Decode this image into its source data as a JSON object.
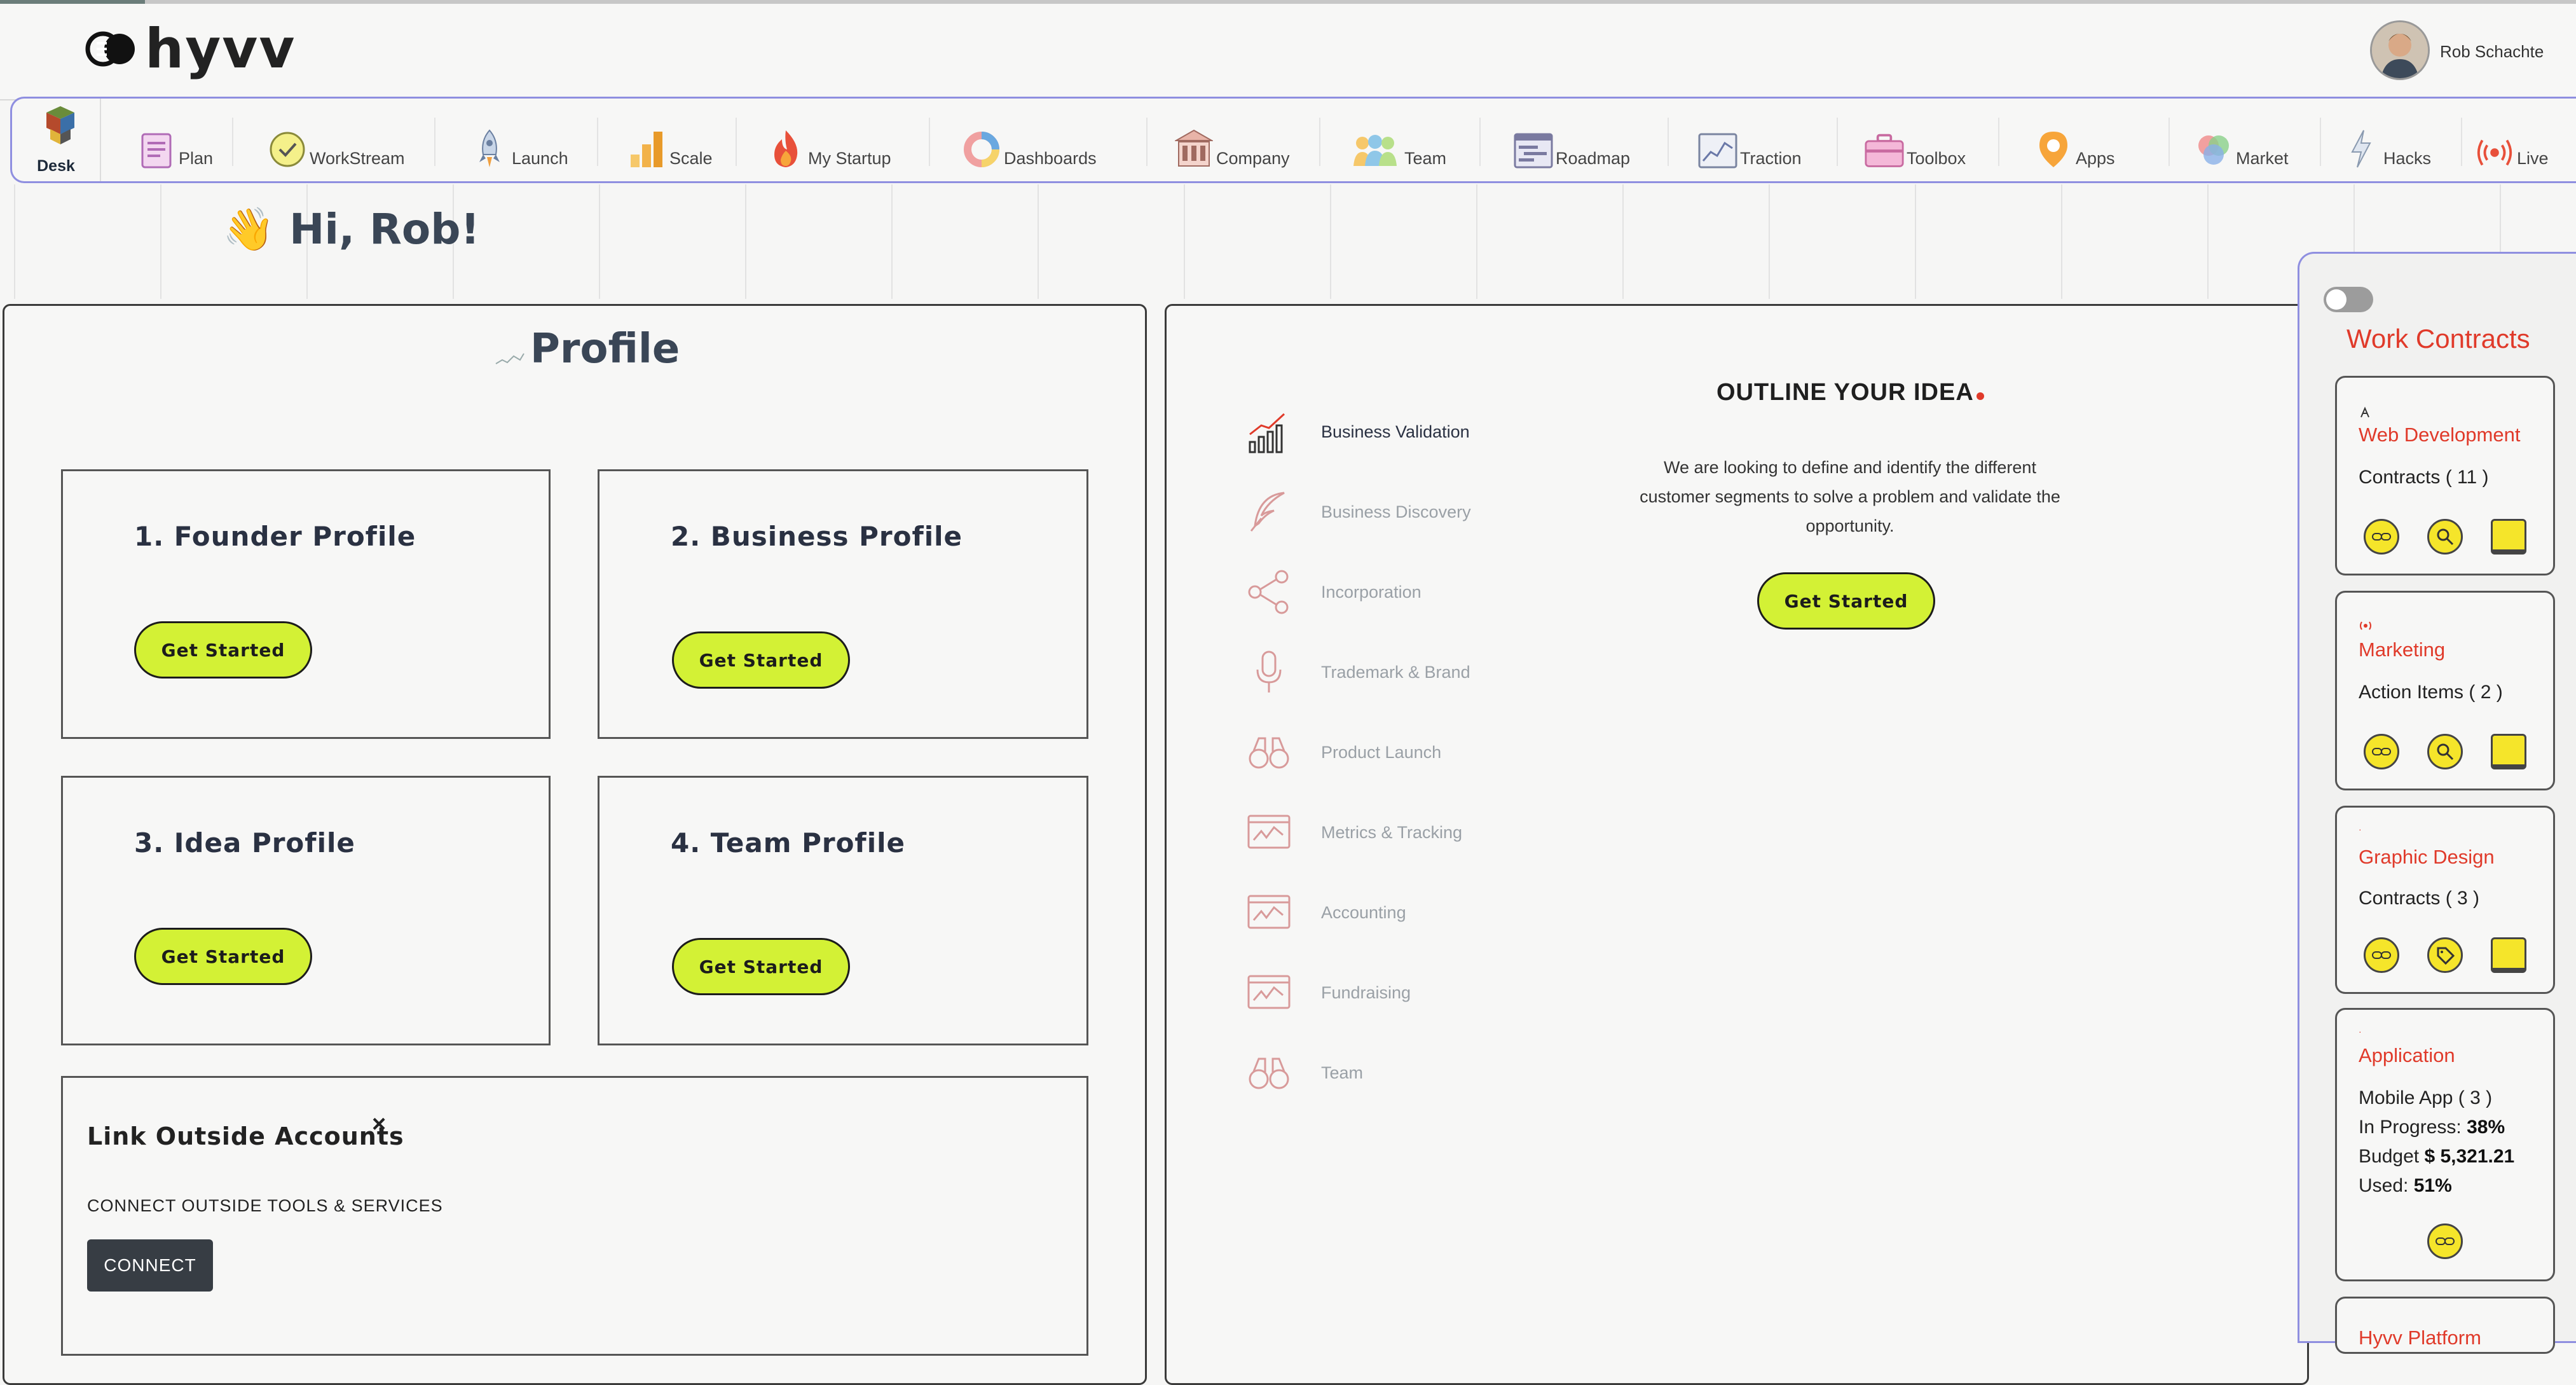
{
  "header": {
    "logo_text": "hyvv",
    "user_name": "Rob Schachte"
  },
  "nav": {
    "desk_label": "Desk",
    "items": [
      {
        "label": "Plan"
      },
      {
        "label": "WorkStream"
      },
      {
        "label": "Launch"
      },
      {
        "label": "Scale"
      },
      {
        "label": "My Startup"
      },
      {
        "label": "Dashboards"
      },
      {
        "label": "Company"
      },
      {
        "label": "Team"
      },
      {
        "label": "Roadmap"
      },
      {
        "label": "Traction"
      },
      {
        "label": "Toolbox"
      },
      {
        "label": "Apps"
      },
      {
        "label": "Market"
      },
      {
        "label": "Hacks"
      },
      {
        "label": "Live"
      }
    ]
  },
  "greeting": {
    "emoji": "👋",
    "text": "Hi, Rob!"
  },
  "profile": {
    "title": "Profile",
    "cards": [
      {
        "title": "1. Founder Profile",
        "button": "Get Started"
      },
      {
        "title": "2. Business Profile",
        "button": "Get Started"
      },
      {
        "title": "3. Idea Profile",
        "button": "Get Started"
      },
      {
        "title": "4. Team Profile",
        "button": "Get Started"
      }
    ],
    "link": {
      "title": "Link Outside Accounts",
      "close": "×",
      "subtitle": "CONNECT OUTSIDE TOOLS & SERVICES",
      "button": "CONNECT"
    }
  },
  "idea": {
    "steps": [
      {
        "label": "Business Validation",
        "icon": "bar-chart-icon"
      },
      {
        "label": "Business Discovery",
        "icon": "feather-icon"
      },
      {
        "label": "Incorporation",
        "icon": "share-icon"
      },
      {
        "label": "Trademark & Brand",
        "icon": "microphone-icon"
      },
      {
        "label": "Product Launch",
        "icon": "binoculars-icon"
      },
      {
        "label": "Metrics & Tracking",
        "icon": "monitor-chart-icon"
      },
      {
        "label": "Accounting",
        "icon": "monitor-chart-icon"
      },
      {
        "label": "Fundraising",
        "icon": "monitor-chart-icon"
      },
      {
        "label": "Team",
        "icon": "binoculars-icon"
      }
    ],
    "title": "OUTLINE YOUR IDEA",
    "description": "We are looking to define and identify the different customer segments to solve a problem and validate the opportunity.",
    "button": "Get Started"
  },
  "sidebar": {
    "title": "Work Contracts",
    "cards": [
      {
        "name": "Web Development",
        "line1": "Contracts ( 11 )"
      },
      {
        "name": "Marketing",
        "line1": "Action Items ( 2 )"
      },
      {
        "name": "Graphic Design",
        "line1": "Contracts ( 3 )"
      },
      {
        "name": "Application",
        "line1": "Mobile App ( 3 )",
        "progress_label": "In Progress:",
        "progress_value": "38%",
        "budget_label": "Budget",
        "budget_value": "$ 5,321.21",
        "used_label": "Used:",
        "used_value": "51%"
      },
      {
        "name": "Hyvv Platform"
      }
    ]
  },
  "colors": {
    "accent_green": "#d3f135",
    "brand_red": "#e03a2a",
    "nav_border": "#8f8fe0",
    "icon_yellow": "#f5e52a"
  }
}
